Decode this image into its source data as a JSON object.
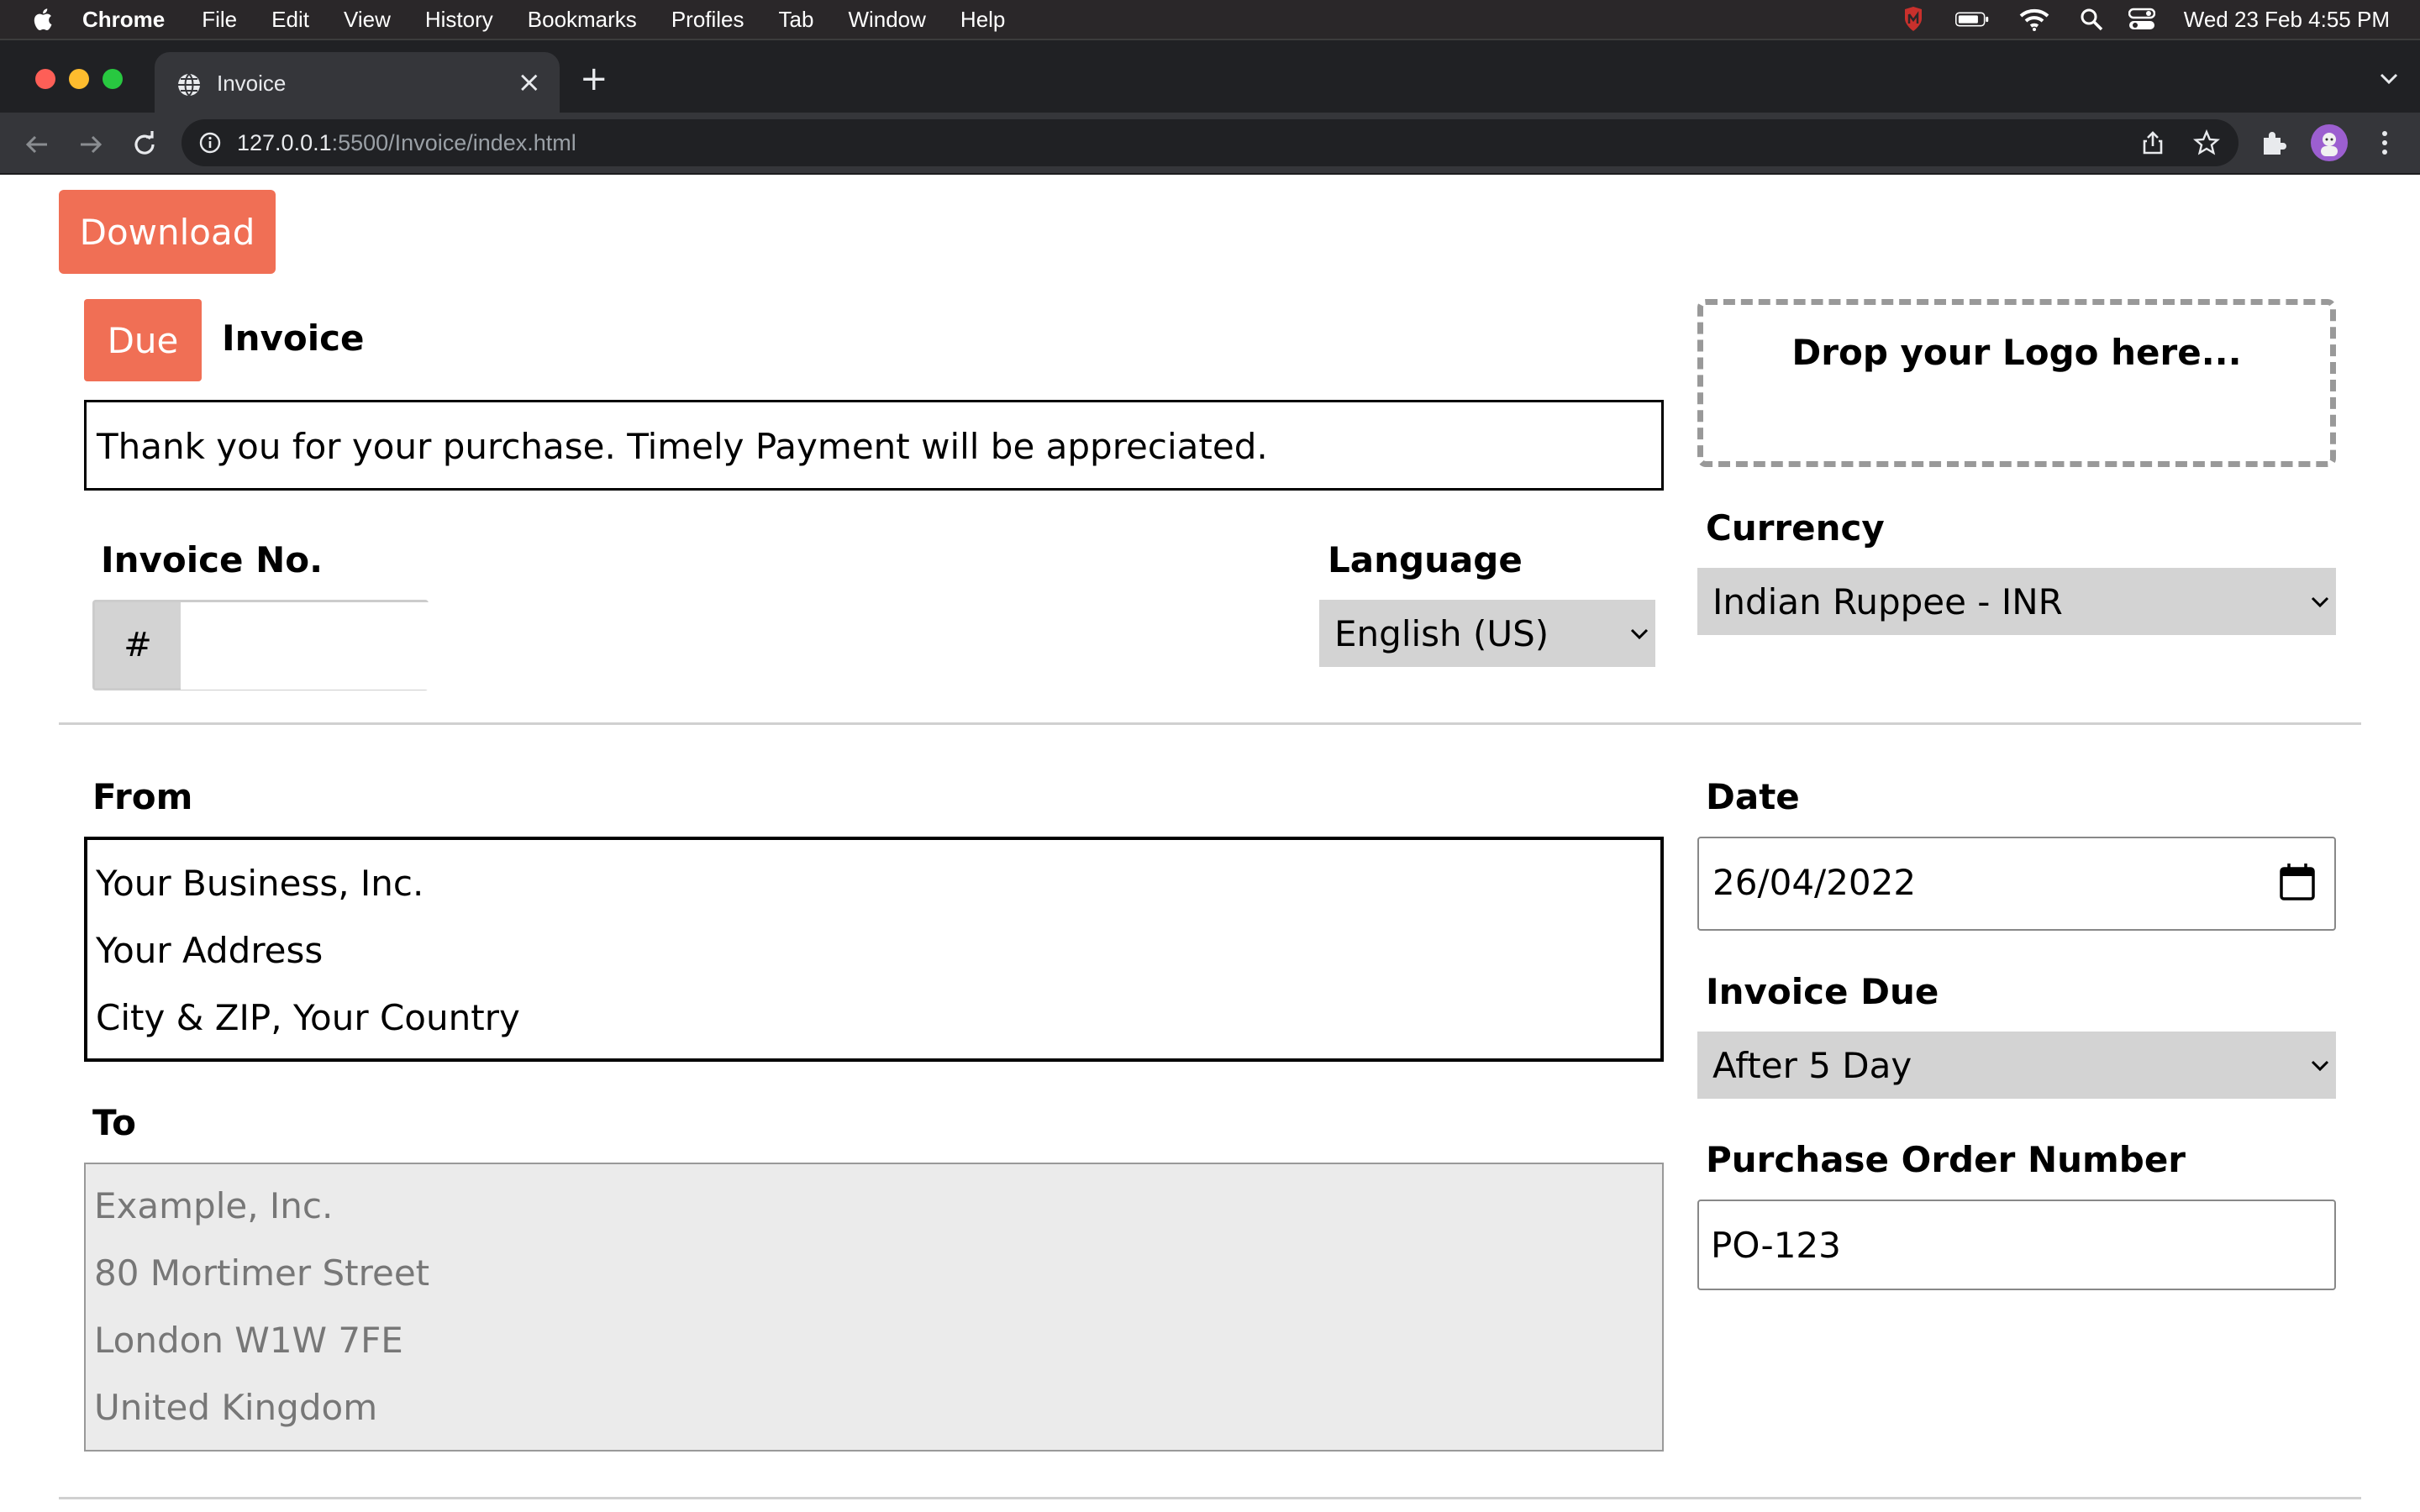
{
  "menubar": {
    "app_name": "Chrome",
    "items": [
      "File",
      "Edit",
      "View",
      "History",
      "Bookmarks",
      "Profiles",
      "Tab",
      "Window",
      "Help"
    ],
    "clock": "Wed 23 Feb  4:55 PM"
  },
  "browser": {
    "tab_title": "Invoice",
    "url_host": "127.0.0.1",
    "url_rest": ":5500/Invoice/index.html"
  },
  "page": {
    "download_label": "Download",
    "status_badge": "Due",
    "invoice_title": "Invoice",
    "thanks_message": "Thank you for your purchase. Timely Payment will be appreciated.",
    "logo_drop_text": "Drop your Logo here...",
    "invoice_no_label": "Invoice No.",
    "invoice_no_prefix": "#",
    "invoice_no_value": "",
    "language_label": "Language",
    "language_selected": "English (US)",
    "currency_label": "Currency",
    "currency_selected": "Indian Ruppee - INR",
    "from_label": "From",
    "from_lines": [
      "Your Business, Inc.",
      "Your Address",
      "City & ZIP, Your Country"
    ],
    "to_label": "To",
    "to_placeholder_lines": [
      "Example, Inc.",
      "80 Mortimer Street",
      "London W1W 7FE",
      "United Kingdom"
    ],
    "date_label": "Date",
    "date_value": "26/04/2022",
    "invoice_due_label": "Invoice Due",
    "invoice_due_selected": "After 5 Day",
    "po_label": "Purchase Order Number",
    "po_value": "PO-123"
  },
  "colors": {
    "accent": "#f06f55",
    "select_bg": "#d3d3d3",
    "to_bg": "#ebebeb"
  }
}
